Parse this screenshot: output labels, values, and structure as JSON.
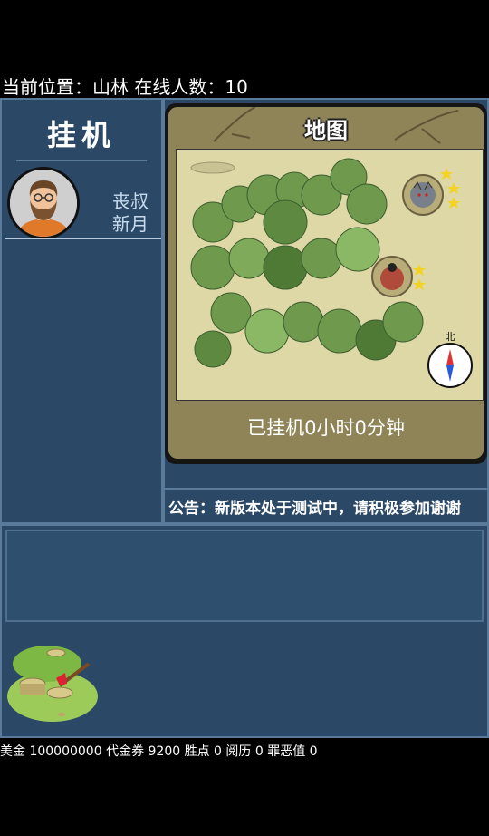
{
  "location": {
    "label": "当前位置：",
    "place": "山林",
    "online_label": "在线人数：",
    "online_count": "10"
  },
  "sidebar": {
    "title": "挂机",
    "player_name_line1": "丧叔",
    "player_name_line2": "新月"
  },
  "map": {
    "title": "地图",
    "compass_label": "北",
    "idle_status": "已挂机0小时0分钟",
    "enemies": [
      {
        "icon": "wolf-icon",
        "stars": 3
      },
      {
        "icon": "boar-icon",
        "stars": 2
      }
    ]
  },
  "notice": "公告：新版本处于测试中，请积极参加谢谢",
  "stats": "美金 100000000 代金券 9200 胜点 0 阅历 0 罪恶值 0",
  "colors": {
    "panel": "#2b4866",
    "border": "#5a7a99",
    "map_frame": "#8f8458",
    "paper": "#ddd8a6",
    "star": "#f5d220"
  }
}
